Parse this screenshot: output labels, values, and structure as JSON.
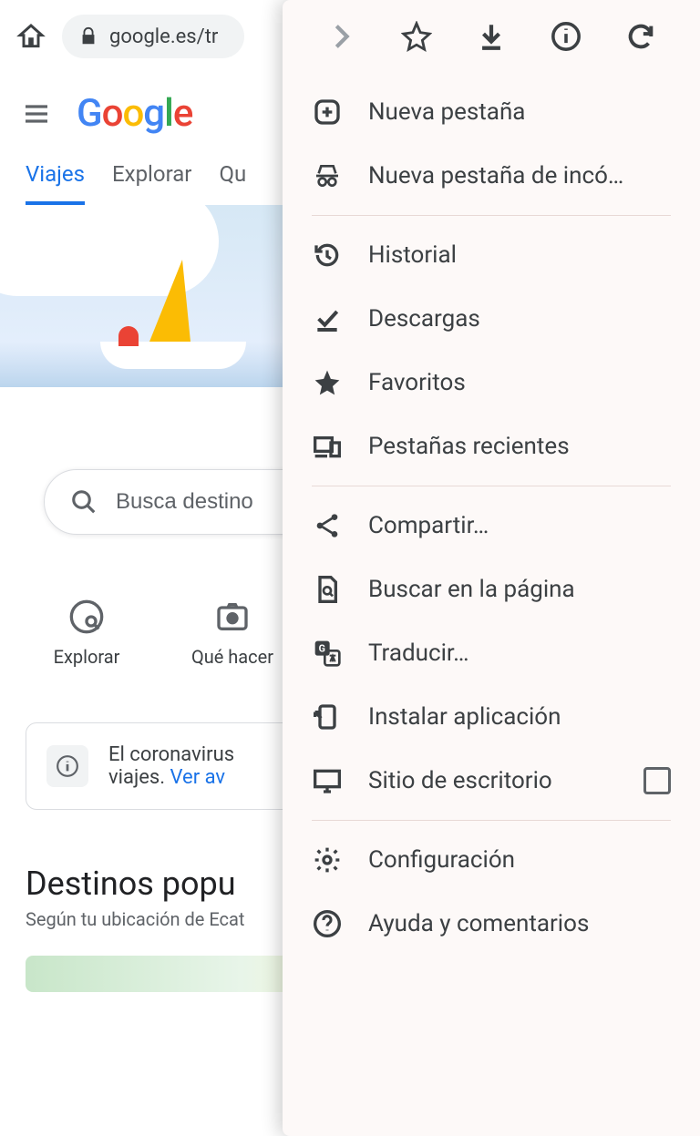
{
  "browser": {
    "url": "google.es/tr"
  },
  "page": {
    "logo": {
      "g1": "G",
      "o1": "o",
      "o2": "o",
      "g2": "g",
      "l": "l",
      "e": "e"
    },
    "tabs": [
      {
        "label": "Viajes",
        "active": true
      },
      {
        "label": "Explorar",
        "active": false
      },
      {
        "label": "Qu"
      }
    ],
    "search": {
      "placeholder": "Busca destino"
    },
    "shortcuts": [
      {
        "label": "Explorar"
      },
      {
        "label": "Qué hacer"
      }
    ],
    "notice": {
      "text_a": "El coronavirus",
      "text_b": "viajes. ",
      "link": "Ver av"
    },
    "section": {
      "title": "Destinos popu",
      "subtitle": "Según tu ubicación de Ecat"
    }
  },
  "menu": {
    "items": [
      {
        "icon": "plus-box",
        "label": "Nueva pestaña"
      },
      {
        "icon": "incognito",
        "label": "Nueva pestaña de incó…"
      },
      {
        "sep": true
      },
      {
        "icon": "history",
        "label": "Historial"
      },
      {
        "icon": "download-done",
        "label": "Descargas"
      },
      {
        "icon": "star-fill",
        "label": "Favoritos"
      },
      {
        "icon": "devices",
        "label": "Pestañas recientes"
      },
      {
        "sep": true
      },
      {
        "icon": "share",
        "label": "Compartir…"
      },
      {
        "icon": "find-page",
        "label": "Buscar en la página"
      },
      {
        "icon": "translate",
        "label": "Traducir…"
      },
      {
        "icon": "install",
        "label": "Instalar aplicación"
      },
      {
        "icon": "desktop",
        "label": "Sitio de escritorio",
        "checkbox": true
      },
      {
        "sep": true
      },
      {
        "icon": "gear",
        "label": "Configuración"
      },
      {
        "icon": "help",
        "label": "Ayuda y comentarios"
      }
    ]
  }
}
